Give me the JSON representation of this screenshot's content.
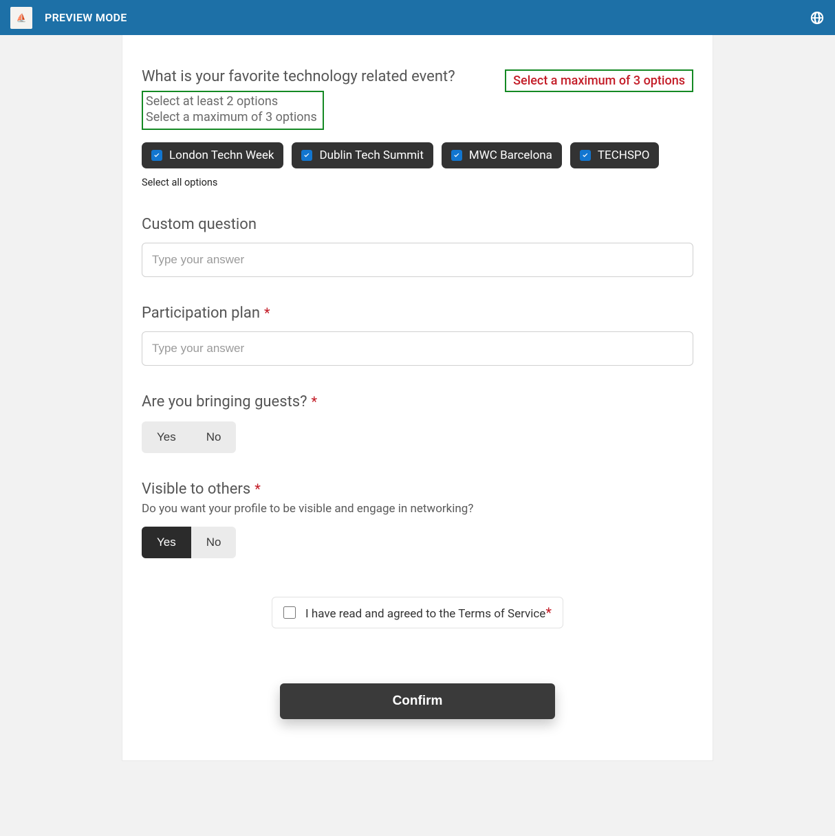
{
  "header": {
    "title": "PREVIEW MODE"
  },
  "question1": {
    "title": "What is your favorite technology related event?",
    "error": "Select a maximum of 3 options",
    "hint1": "Select at least 2 options",
    "hint2": "Select a maximum of 3 options",
    "options": [
      {
        "label": "London Techn Week"
      },
      {
        "label": "Dublin Tech Summit"
      },
      {
        "label": "MWC Barcelona"
      },
      {
        "label": "TECHSPO"
      }
    ],
    "select_all": "Select all options"
  },
  "custom_question": {
    "label": "Custom question",
    "placeholder": "Type your answer"
  },
  "participation": {
    "label": "Participation plan",
    "placeholder": "Type your answer"
  },
  "guests": {
    "label": "Are you bringing guests?",
    "yes": "Yes",
    "no": "No"
  },
  "visible": {
    "label": "Visible to others",
    "subtext": "Do you want your profile to be visible and engage in networking?",
    "yes": "Yes",
    "no": "No"
  },
  "terms": {
    "label": "I have read and agreed to the Terms of Service"
  },
  "confirm": "Confirm"
}
